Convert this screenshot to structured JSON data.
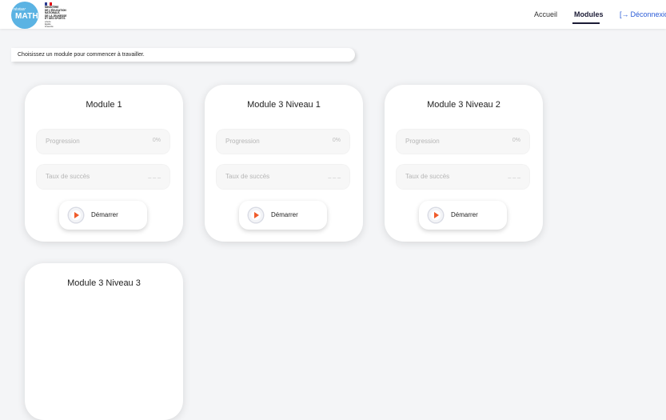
{
  "header": {
    "logo_small": "réviser",
    "logo_big": "MATH",
    "ministry": "MINISTÈRE\nDE L'ÉDUCATION\nNATIONALE,\nDE LA JEUNESSE\nET DES SPORTS",
    "ministry_motto": "Liberté\nÉgalité\nFraternité",
    "nav": {
      "home": "Accueil",
      "modules": "Modules",
      "logout": "Déconnexion"
    },
    "colors": {
      "accent": "#1b1b35",
      "logout": "#2a5bd7",
      "logo_bg": "#5bb3e3"
    }
  },
  "instruction": "Choisissez un module pour commencer à travailler.",
  "modules": [
    {
      "title": "Module 1",
      "progress_label": "Progression",
      "progress_value": "0%",
      "success_label": "Taux de succès",
      "success_value": "_ _ _",
      "button": "Démarrer"
    },
    {
      "title": "Module 3 Niveau 1",
      "progress_label": "Progression",
      "progress_value": "0%",
      "success_label": "Taux de succès",
      "success_value": "_ _ _",
      "button": "Démarrer"
    },
    {
      "title": "Module 3 Niveau 2",
      "progress_label": "Progression",
      "progress_value": "0%",
      "success_label": "Taux de succès",
      "success_value": "_ _ _",
      "button": "Démarrer"
    },
    {
      "title": "Module 3 Niveau 3"
    }
  ],
  "icons": {
    "play": "play-circle-icon",
    "logout": "logout-icon"
  },
  "play_color": "#ef5b2b"
}
